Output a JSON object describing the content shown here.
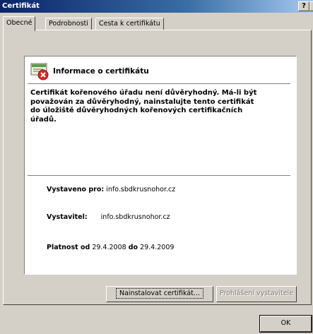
{
  "window": {
    "title": "Certifikát",
    "help_label": "?",
    "close_label": "×"
  },
  "tabs": [
    {
      "label": "Obecné"
    },
    {
      "label": "Podrobnosti"
    },
    {
      "label": "Cesta k certifikátu"
    }
  ],
  "info": {
    "title": "Informace o certifikátu",
    "warning": "Certifikát kořenového úřadu není důvěryhodný. Má-li být považován za důvěryhodný, nainstalujte tento certifikát do úložiště důvěryhodných kořenových certifikačních úřadů."
  },
  "details": {
    "issued_to_label": "Vystaveno pro:",
    "issued_to_value": "info.sbdkrusnohor.cz",
    "issued_by_label": "Vystavitel:",
    "issued_by_value": "info.sbdkrusnohor.cz",
    "validity_label": "Platnost od",
    "valid_from": "29.4.2008",
    "to_label": "do",
    "valid_to": "29.4.2009"
  },
  "buttons": {
    "install_label": "Nainstalovat certifikát...",
    "statement_label": "Prohlášení vystavitele",
    "ok_label": "OK"
  }
}
